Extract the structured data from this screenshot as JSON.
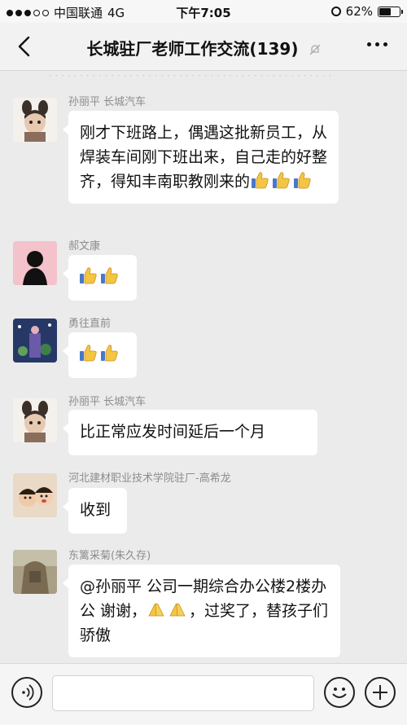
{
  "status": {
    "carrier": "中国联通",
    "network": "4G",
    "time": "下午7:05",
    "battery": "62%",
    "battery_level": 0.62
  },
  "header": {
    "title": "长城驻厂老师工作交流(139)"
  },
  "messages": [
    {
      "sender": "孙丽平 长城汽车",
      "text": "刚才下班路上，偶遇这批新员工，从焊装车间刚下班出来，自己走的好整齐，得知丰南职教刚来的",
      "thumbs": 3
    },
    {
      "sender": "郝文康",
      "text": "",
      "thumbs": 2
    },
    {
      "sender": "勇往直前",
      "text": "",
      "thumbs": 2
    },
    {
      "sender": "孙丽平 长城汽车",
      "text": "比正常应发时间延后一个月",
      "thumbs": 0
    },
    {
      "sender": "河北建材职业技术学院驻厂-高希龙",
      "text": "收到",
      "thumbs": 0
    },
    {
      "sender": "东篱采菊(朱久存)",
      "text": "@孙丽平 公司一期综合办公楼2楼办公 谢谢，",
      "text_after": "，过奖了，替孩子们骄傲",
      "claps": 2
    }
  ],
  "colors": {
    "background": "#ebebeb",
    "bubble": "#ffffff",
    "sender": "#8c8c8c"
  }
}
